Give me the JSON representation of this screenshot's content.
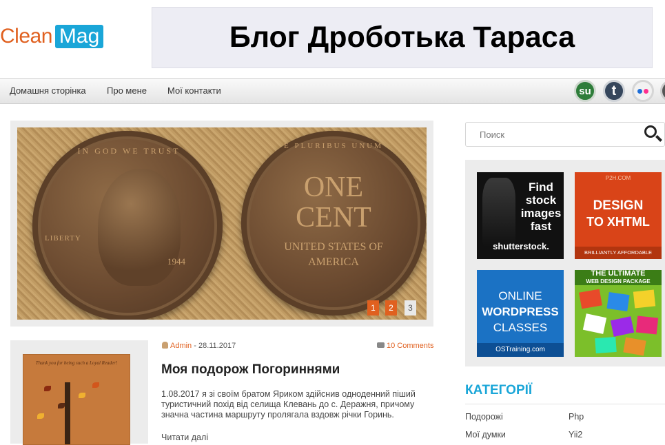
{
  "header": {
    "logo_part1": "Clean",
    "logo_part2": "Mag",
    "banner_title": "Блог Дроботька Тараса"
  },
  "nav": {
    "items": [
      "Домашня сторінка",
      "Про мене",
      "Мої контакти"
    ]
  },
  "social": [
    "stumbleupon-icon",
    "tumblr-icon",
    "flickr-icon",
    "extra-icon"
  ],
  "slider": {
    "coin_left": {
      "top": "IN GOD WE TRUST",
      "left": "LIBERTY",
      "year": "1944"
    },
    "coin_right": {
      "top": "E PLURIBUS UNUM",
      "main": "ONE CENT",
      "bottom": "UNITED STATES OF AMERICA"
    },
    "pages": [
      "1",
      "2",
      "3"
    ],
    "active_page": 1
  },
  "post": {
    "thumb_caption": "Thank you for being such a Loyal Reader!",
    "author": "Admin",
    "date": " - 28.11.2017",
    "comments": "10 Comments",
    "title": "Моя подорож Погориннями",
    "excerpt": "1.08.2017 я зі своїм братом Яриком здійснив одноденний піший туристичний похід від селища Клевань до с. Деражня, причому значна частина маршруту пролягала вздовж річки Горинь.",
    "read_more": "Читати далі"
  },
  "sidebar": {
    "search_placeholder": "Поиск",
    "ads": [
      {
        "line1": "Find",
        "line2": "stock",
        "line3": "images",
        "line4": "fast",
        "brand": "shutterstock."
      },
      {
        "top": "P2H.COM",
        "line1": "DESIGN",
        "line2": "TO XHTML",
        "bottom": "BRILLIANTLY AFFORDABLE"
      },
      {
        "line1": "ONLINE",
        "line2": "WORDPRESS",
        "line3": "CLASSES",
        "brand": "OSTraining.com"
      },
      {
        "line1": "THE ULTIMATE",
        "line2": "WEB DESIGN PACKAGE"
      }
    ],
    "categories_title": "КАТЕГОРІЇ",
    "categories": [
      {
        "left": "Подорожі",
        "right": "Php"
      },
      {
        "left": "Мої думки",
        "right": "Yii2"
      }
    ]
  },
  "colors": {
    "accent_orange": "#e0601f",
    "accent_blue": "#1aa6d8"
  }
}
